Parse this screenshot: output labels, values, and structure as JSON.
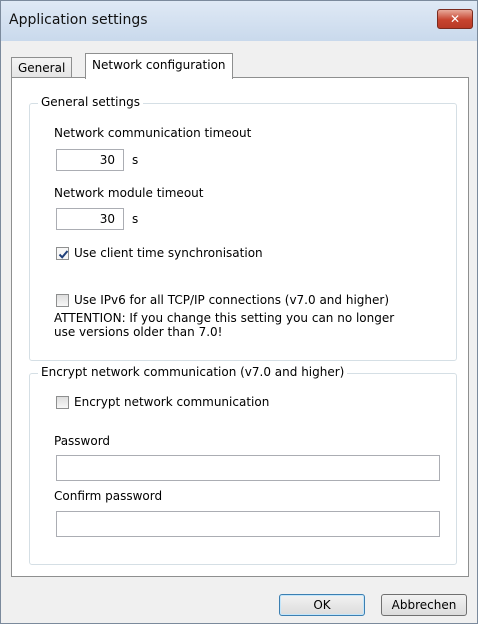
{
  "window": {
    "title": "Application settings",
    "close_icon": "close-icon"
  },
  "tabs": [
    {
      "label": "General",
      "active": false
    },
    {
      "label": "Network configuration",
      "active": true
    }
  ],
  "general_settings": {
    "legend": "General settings",
    "comm_timeout_label": "Network communication timeout",
    "comm_timeout_value": "30",
    "comm_timeout_unit": "s",
    "module_timeout_label": "Network module timeout",
    "module_timeout_value": "30",
    "module_timeout_unit": "s",
    "time_sync_label": "Use client time synchronisation",
    "time_sync_checked": true,
    "ipv6_label": "Use IPv6 for all TCP/IP connections (v7.0 and higher)",
    "ipv6_checked": false,
    "attention_line1": "ATTENTION: If you change this setting you can no longer",
    "attention_line2": "use versions older than 7.0!"
  },
  "encrypt": {
    "legend": "Encrypt network communication  (v7.0 and higher)",
    "checkbox_label": "Encrypt network communication",
    "checked": false,
    "password_label": "Password",
    "password_value": "",
    "confirm_label": "Confirm password",
    "confirm_value": ""
  },
  "buttons": {
    "ok": "OK",
    "cancel": "Abbrechen"
  }
}
